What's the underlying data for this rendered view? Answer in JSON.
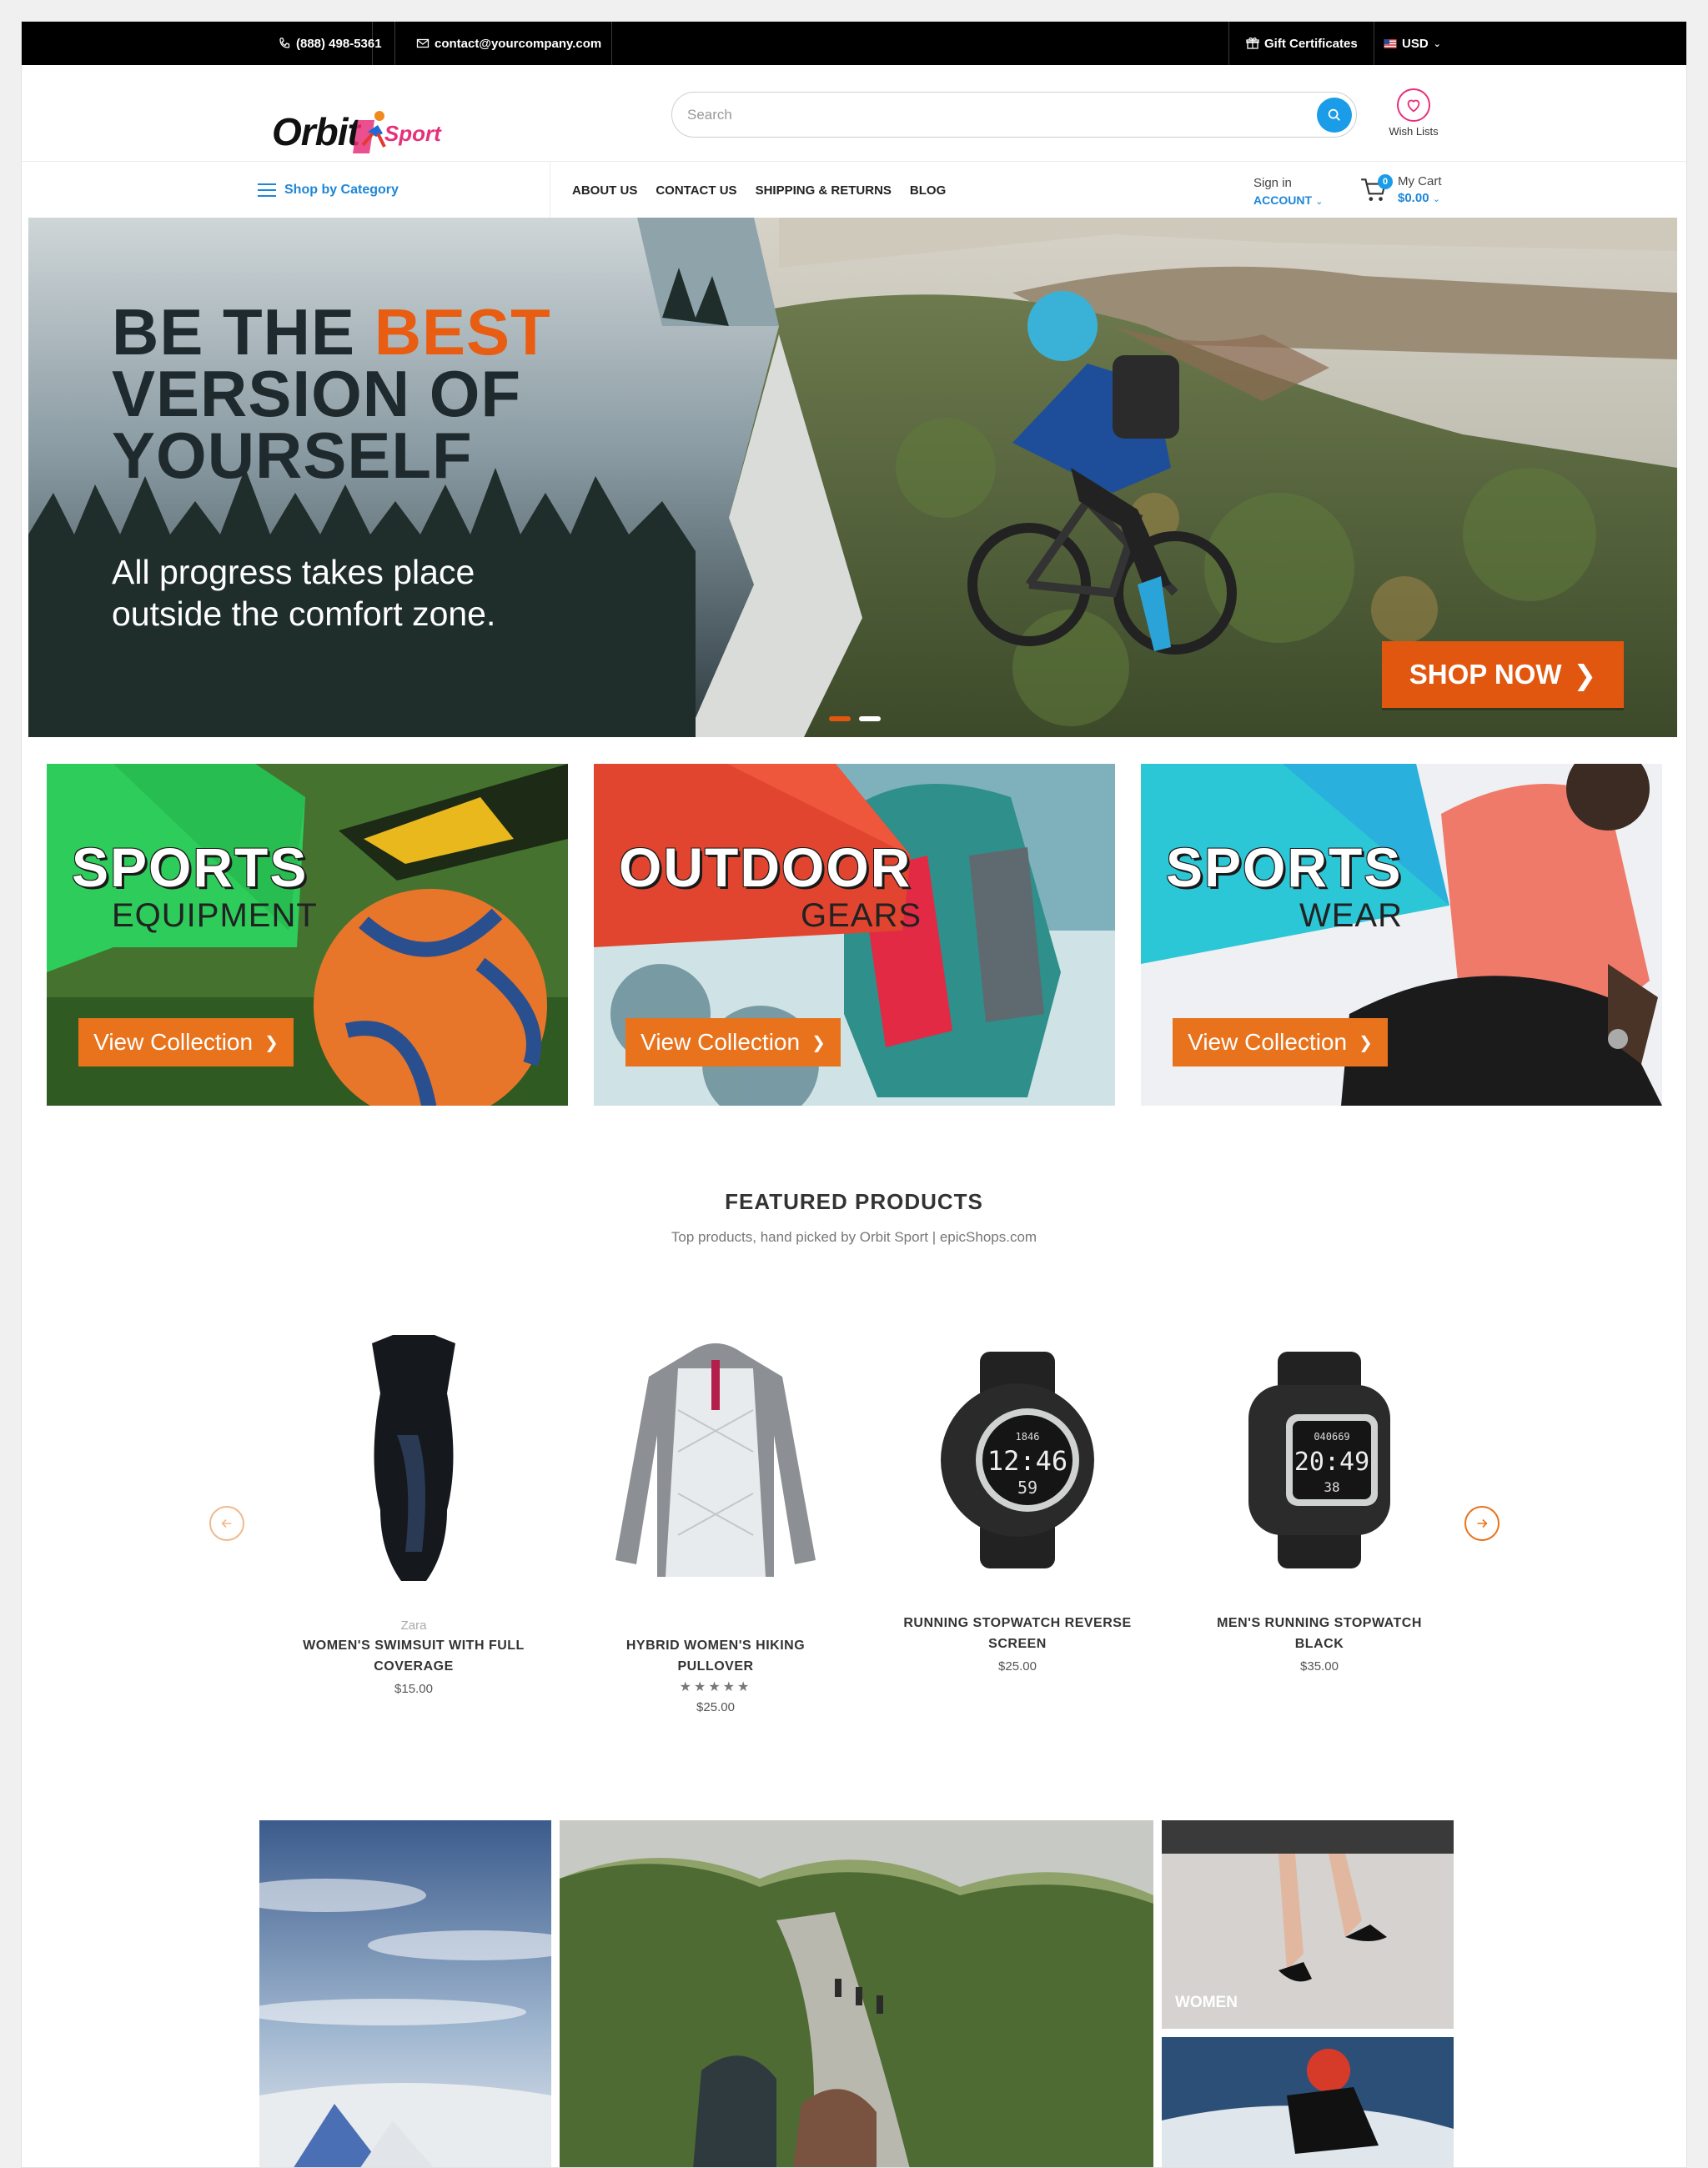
{
  "topbar": {
    "phone": "(888) 498-5361",
    "email": "contact@yourcompany.com",
    "gift": "Gift Certificates",
    "currency": "USD"
  },
  "header": {
    "logo_main": "Orbit",
    "logo_sub": "Sport",
    "search_placeholder": "Search",
    "wishlist_label": "Wish Lists"
  },
  "nav": {
    "category_label": "Shop by Category",
    "links": [
      "ABOUT US",
      "CONTACT US",
      "SHIPPING & RETURNS",
      "BLOG"
    ],
    "signin_label": "Sign in",
    "account_label": "ACCOUNT",
    "cart_label": "My Cart",
    "cart_amount": "$0.00",
    "cart_count": "0"
  },
  "hero": {
    "headline_line1_a": "BE THE ",
    "headline_line1_b": "BEST",
    "headline_line2": "VERSION OF",
    "headline_line3": "YOURSELF",
    "subline": "All progress takes place outside the comfort zone.",
    "cta": "SHOP NOW"
  },
  "categories": [
    {
      "title": "SPORTS",
      "subtitle": "EQUIPMENT",
      "cta": "View Collection"
    },
    {
      "title": "OUTDOOR",
      "subtitle": "GEARS",
      "cta": "View Collection"
    },
    {
      "title": "SPORTS",
      "subtitle": "WEAR",
      "cta": "View Collection"
    }
  ],
  "featured": {
    "title": "FEATURED PRODUCTS",
    "subtitle": "Top products, hand picked by Orbit Sport | epicShops.com",
    "products": [
      {
        "brand": "Zara",
        "name": "WOMEN'S SWIMSUIT WITH FULL COVERAGE",
        "price": "$15.00"
      },
      {
        "brand": "",
        "name": "HYBRID WOMEN'S HIKING PULLOVER",
        "rating": "★★★★★",
        "price": "$25.00"
      },
      {
        "brand": "",
        "name": "RUNNING STOPWATCH REVERSE SCREEN",
        "price": "$25.00",
        "watch_top": "1846",
        "watch_main": "12:46",
        "watch_bottom": "59"
      },
      {
        "brand": "",
        "name": "MEN'S RUNNING STOPWATCH BLACK",
        "price": "$35.00",
        "watch_top": "040669",
        "watch_main": "20:49",
        "watch_bottom": "38"
      }
    ]
  },
  "gallery": {
    "women_label": "WOMEN"
  },
  "colors": {
    "accent_orange": "#e2570f",
    "link_blue": "#1d86d8",
    "brand_pink": "#e7307a"
  }
}
